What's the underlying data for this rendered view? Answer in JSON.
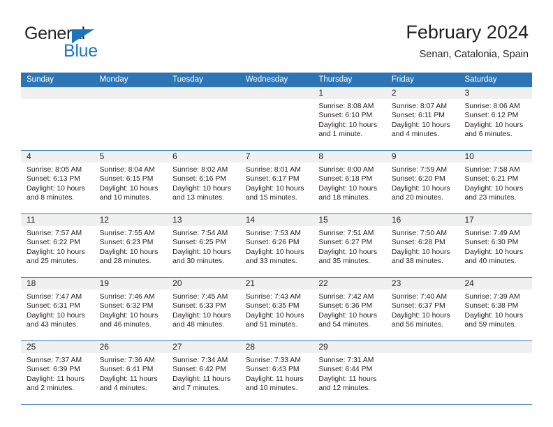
{
  "brand": {
    "name_primary": "General",
    "name_secondary": "Blue"
  },
  "header": {
    "title": "February 2024",
    "subtitle": "Senan, Catalonia, Spain"
  },
  "colors": {
    "header_blue": "#2E75B6",
    "logo_blue": "#1B76BC",
    "day_band_gray": "#F0F0F0",
    "text": "#231F20"
  },
  "weekdays": [
    "Sunday",
    "Monday",
    "Tuesday",
    "Wednesday",
    "Thursday",
    "Friday",
    "Saturday"
  ],
  "labels": {
    "sunrise_prefix": "Sunrise:",
    "sunset_prefix": "Sunset:",
    "daylight_prefix": "Daylight:"
  },
  "weeks": [
    [
      {
        "day": "",
        "empty": true
      },
      {
        "day": "",
        "empty": true
      },
      {
        "day": "",
        "empty": true
      },
      {
        "day": "",
        "empty": true
      },
      {
        "day": "1",
        "sunrise": "Sunrise: 8:08 AM",
        "sunset": "Sunset: 6:10 PM",
        "daylight": "Daylight: 10 hours and 1 minute."
      },
      {
        "day": "2",
        "sunrise": "Sunrise: 8:07 AM",
        "sunset": "Sunset: 6:11 PM",
        "daylight": "Daylight: 10 hours and 4 minutes."
      },
      {
        "day": "3",
        "sunrise": "Sunrise: 8:06 AM",
        "sunset": "Sunset: 6:12 PM",
        "daylight": "Daylight: 10 hours and 6 minutes."
      }
    ],
    [
      {
        "day": "4",
        "sunrise": "Sunrise: 8:05 AM",
        "sunset": "Sunset: 6:13 PM",
        "daylight": "Daylight: 10 hours and 8 minutes."
      },
      {
        "day": "5",
        "sunrise": "Sunrise: 8:04 AM",
        "sunset": "Sunset: 6:15 PM",
        "daylight": "Daylight: 10 hours and 10 minutes."
      },
      {
        "day": "6",
        "sunrise": "Sunrise: 8:02 AM",
        "sunset": "Sunset: 6:16 PM",
        "daylight": "Daylight: 10 hours and 13 minutes."
      },
      {
        "day": "7",
        "sunrise": "Sunrise: 8:01 AM",
        "sunset": "Sunset: 6:17 PM",
        "daylight": "Daylight: 10 hours and 15 minutes."
      },
      {
        "day": "8",
        "sunrise": "Sunrise: 8:00 AM",
        "sunset": "Sunset: 6:18 PM",
        "daylight": "Daylight: 10 hours and 18 minutes."
      },
      {
        "day": "9",
        "sunrise": "Sunrise: 7:59 AM",
        "sunset": "Sunset: 6:20 PM",
        "daylight": "Daylight: 10 hours and 20 minutes."
      },
      {
        "day": "10",
        "sunrise": "Sunrise: 7:58 AM",
        "sunset": "Sunset: 6:21 PM",
        "daylight": "Daylight: 10 hours and 23 minutes."
      }
    ],
    [
      {
        "day": "11",
        "sunrise": "Sunrise: 7:57 AM",
        "sunset": "Sunset: 6:22 PM",
        "daylight": "Daylight: 10 hours and 25 minutes."
      },
      {
        "day": "12",
        "sunrise": "Sunrise: 7:55 AM",
        "sunset": "Sunset: 6:23 PM",
        "daylight": "Daylight: 10 hours and 28 minutes."
      },
      {
        "day": "13",
        "sunrise": "Sunrise: 7:54 AM",
        "sunset": "Sunset: 6:25 PM",
        "daylight": "Daylight: 10 hours and 30 minutes."
      },
      {
        "day": "14",
        "sunrise": "Sunrise: 7:53 AM",
        "sunset": "Sunset: 6:26 PM",
        "daylight": "Daylight: 10 hours and 33 minutes."
      },
      {
        "day": "15",
        "sunrise": "Sunrise: 7:51 AM",
        "sunset": "Sunset: 6:27 PM",
        "daylight": "Daylight: 10 hours and 35 minutes."
      },
      {
        "day": "16",
        "sunrise": "Sunrise: 7:50 AM",
        "sunset": "Sunset: 6:28 PM",
        "daylight": "Daylight: 10 hours and 38 minutes."
      },
      {
        "day": "17",
        "sunrise": "Sunrise: 7:49 AM",
        "sunset": "Sunset: 6:30 PM",
        "daylight": "Daylight: 10 hours and 40 minutes."
      }
    ],
    [
      {
        "day": "18",
        "sunrise": "Sunrise: 7:47 AM",
        "sunset": "Sunset: 6:31 PM",
        "daylight": "Daylight: 10 hours and 43 minutes."
      },
      {
        "day": "19",
        "sunrise": "Sunrise: 7:46 AM",
        "sunset": "Sunset: 6:32 PM",
        "daylight": "Daylight: 10 hours and 46 minutes."
      },
      {
        "day": "20",
        "sunrise": "Sunrise: 7:45 AM",
        "sunset": "Sunset: 6:33 PM",
        "daylight": "Daylight: 10 hours and 48 minutes."
      },
      {
        "day": "21",
        "sunrise": "Sunrise: 7:43 AM",
        "sunset": "Sunset: 6:35 PM",
        "daylight": "Daylight: 10 hours and 51 minutes."
      },
      {
        "day": "22",
        "sunrise": "Sunrise: 7:42 AM",
        "sunset": "Sunset: 6:36 PM",
        "daylight": "Daylight: 10 hours and 54 minutes."
      },
      {
        "day": "23",
        "sunrise": "Sunrise: 7:40 AM",
        "sunset": "Sunset: 6:37 PM",
        "daylight": "Daylight: 10 hours and 56 minutes."
      },
      {
        "day": "24",
        "sunrise": "Sunrise: 7:39 AM",
        "sunset": "Sunset: 6:38 PM",
        "daylight": "Daylight: 10 hours and 59 minutes."
      }
    ],
    [
      {
        "day": "25",
        "sunrise": "Sunrise: 7:37 AM",
        "sunset": "Sunset: 6:39 PM",
        "daylight": "Daylight: 11 hours and 2 minutes."
      },
      {
        "day": "26",
        "sunrise": "Sunrise: 7:36 AM",
        "sunset": "Sunset: 6:41 PM",
        "daylight": "Daylight: 11 hours and 4 minutes."
      },
      {
        "day": "27",
        "sunrise": "Sunrise: 7:34 AM",
        "sunset": "Sunset: 6:42 PM",
        "daylight": "Daylight: 11 hours and 7 minutes."
      },
      {
        "day": "28",
        "sunrise": "Sunrise: 7:33 AM",
        "sunset": "Sunset: 6:43 PM",
        "daylight": "Daylight: 11 hours and 10 minutes."
      },
      {
        "day": "29",
        "sunrise": "Sunrise: 7:31 AM",
        "sunset": "Sunset: 6:44 PM",
        "daylight": "Daylight: 11 hours and 12 minutes."
      },
      {
        "day": "",
        "empty": true
      },
      {
        "day": "",
        "empty": true
      }
    ]
  ]
}
